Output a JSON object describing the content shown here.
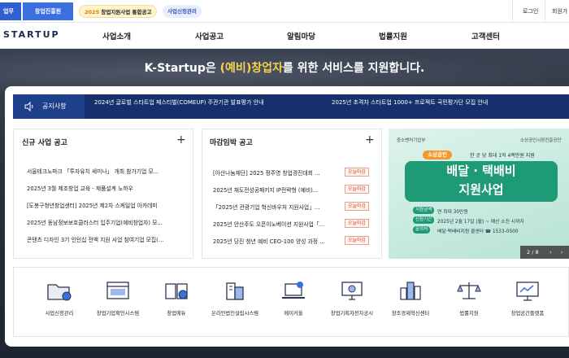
{
  "topbar": {
    "tab1": "업무",
    "tab2": "창업진흥원",
    "pill1_year": "2025",
    "pill1_text": "창업지원사업 통합공고",
    "pill2": "사업신청관리",
    "login": "로그인",
    "signup": "회원가"
  },
  "nav": {
    "logo": "STARTUP",
    "items": [
      "사업소개",
      "사업공고",
      "알림마당",
      "법률지원",
      "고객센터"
    ]
  },
  "hero": {
    "title_pre": "K-Startup은 ",
    "title_hl": "(예비)창업자",
    "title_post": "를 위한 서비스를 지원합니다."
  },
  "notice": {
    "label": "공지사항",
    "items": [
      "2024년 글로벌 스타트업 페스티벌(COMEUP) 주관기관 발표평가 안내",
      "2025년 초격차 스타트업 1000+ 프로젝트 국민평가단 모집 안내"
    ]
  },
  "new_biz": {
    "title": "신규 사업 공고",
    "items": [
      "서울테크노파크 「투자유치 세미나」 개최 참가기업 모...",
      "2025년 3월 제조창업 교육 - 제품설계 노하우",
      "[도봉구청년창업센터] 2025년 제2차 스케일업 아카데미",
      "2025년 동남정보보호클러스터 입주기업(예비창업자) 모...",
      "콘텐츠 디자인 3기 인턴십 전액 지원 사업 참여기업 모집(..."
    ]
  },
  "deadline": {
    "title": "마감임박 공고",
    "badge": "오늘마감",
    "items": [
      "[아산나눔재단] 2025 정주영 창업경진대회 ...",
      "2025년 재도전성공패키지 IP전략형 (예비)...",
      "「2025년 관광기업 혁신바우처 지원사업」...",
      "2025년 안산주도 오픈이노베이션 지원사업「...",
      "2025년 당진 청년 예비 CEO-100 양성 과정 ..."
    ]
  },
  "banner": {
    "org_left": "중소벤처기업부",
    "org_right": "소상공인시장진흥공단",
    "tag": "소상공인",
    "sub": "한 곳 당 최대 1억 4백만원 지원",
    "title_line1": "배달 · 택배비",
    "title_line2": "지원사업",
    "row1_label": "지원금액",
    "row1_text": "연 최대 30만원",
    "row2_label": "신청기간",
    "row2_text": "2025년 2월 17일 (월) ~ 예산 소진 시까지",
    "row3_label": "문의처",
    "row3_text": "배달·택배비지원 콜센터 ☎ 1533-0500",
    "page": "2 / 8"
  },
  "quick": {
    "items": [
      {
        "label": "사업신청관리",
        "icon": "folder-icon"
      },
      {
        "label": "창업기업확인시스템",
        "icon": "web-window-icon"
      },
      {
        "label": "창업에듀",
        "icon": "book-icon"
      },
      {
        "label": "온라인법인설립시스템",
        "icon": "building-icon"
      },
      {
        "label": "메이커올",
        "icon": "laptop-icon"
      },
      {
        "label": "창업기획자전자공시",
        "icon": "monitor-icon"
      },
      {
        "label": "창조경제혁신센터",
        "icon": "city-icon"
      },
      {
        "label": "법률지원",
        "icon": "scale-icon"
      },
      {
        "label": "창업공간플랫폼",
        "icon": "presentation-icon"
      }
    ]
  },
  "colors": {
    "accent": "#2f5fd3",
    "notice_bg": "#16306e",
    "highlight": "#f5d34a",
    "badge": "#d94a26",
    "banner_green": "#1f9a76"
  }
}
